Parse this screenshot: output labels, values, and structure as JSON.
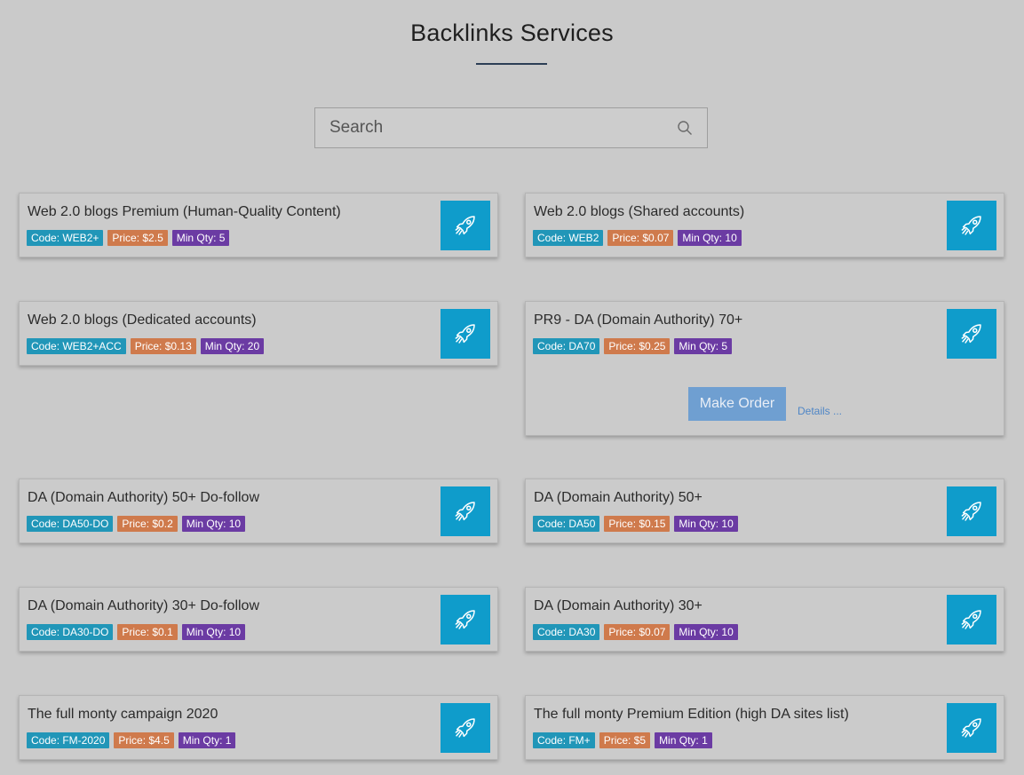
{
  "header": {
    "title": "Backlinks Services"
  },
  "search": {
    "placeholder": "Search"
  },
  "colors": {
    "accent": "#0f9ccb",
    "code_badge": "#2196b8",
    "price_badge": "#cf7a4c",
    "qty_badge": "#6b3ba3",
    "make_order": "#6f9fd1"
  },
  "icons": {
    "search": "search-icon",
    "order": "rocket-icon"
  },
  "services": [
    {
      "title": "Web 2.0 blogs Premium (Human-Quality Content)",
      "code": "Code: WEB2+",
      "price": "Price: $2.5",
      "min_qty": "Min Qty: 5"
    },
    {
      "title": "Web 2.0 blogs (Shared accounts)",
      "code": "Code: WEB2",
      "price": "Price: $0.07",
      "min_qty": "Min Qty: 10"
    },
    {
      "title": "Web 2.0 blogs (Dedicated accounts)",
      "code": "Code: WEB2+ACC",
      "price": "Price: $0.13",
      "min_qty": "Min Qty: 20"
    },
    {
      "title": "PR9 - DA (Domain Authority) 70+",
      "code": "Code: DA70",
      "price": "Price: $0.25",
      "min_qty": "Min Qty: 5",
      "make_order_label": "Make Order",
      "details_label": "Details ..."
    },
    {
      "title": "DA (Domain Authority) 50+ Do-follow",
      "code": "Code: DA50-DO",
      "price": "Price: $0.2",
      "min_qty": "Min Qty: 10"
    },
    {
      "title": "DA (Domain Authority) 50+",
      "code": "Code: DA50",
      "price": "Price: $0.15",
      "min_qty": "Min Qty: 10"
    },
    {
      "title": "DA (Domain Authority) 30+ Do-follow",
      "code": "Code: DA30-DO",
      "price": "Price: $0.1",
      "min_qty": "Min Qty: 10"
    },
    {
      "title": "DA (Domain Authority) 30+",
      "code": "Code: DA30",
      "price": "Price: $0.07",
      "min_qty": "Min Qty: 10"
    },
    {
      "title": "The full monty campaign 2020",
      "code": "Code: FM-2020",
      "price": "Price: $4.5",
      "min_qty": "Min Qty: 1"
    },
    {
      "title": "The full monty Premium Edition (high DA sites list)",
      "code": "Code: FM+",
      "price": "Price: $5",
      "min_qty": "Min Qty: 1"
    }
  ]
}
